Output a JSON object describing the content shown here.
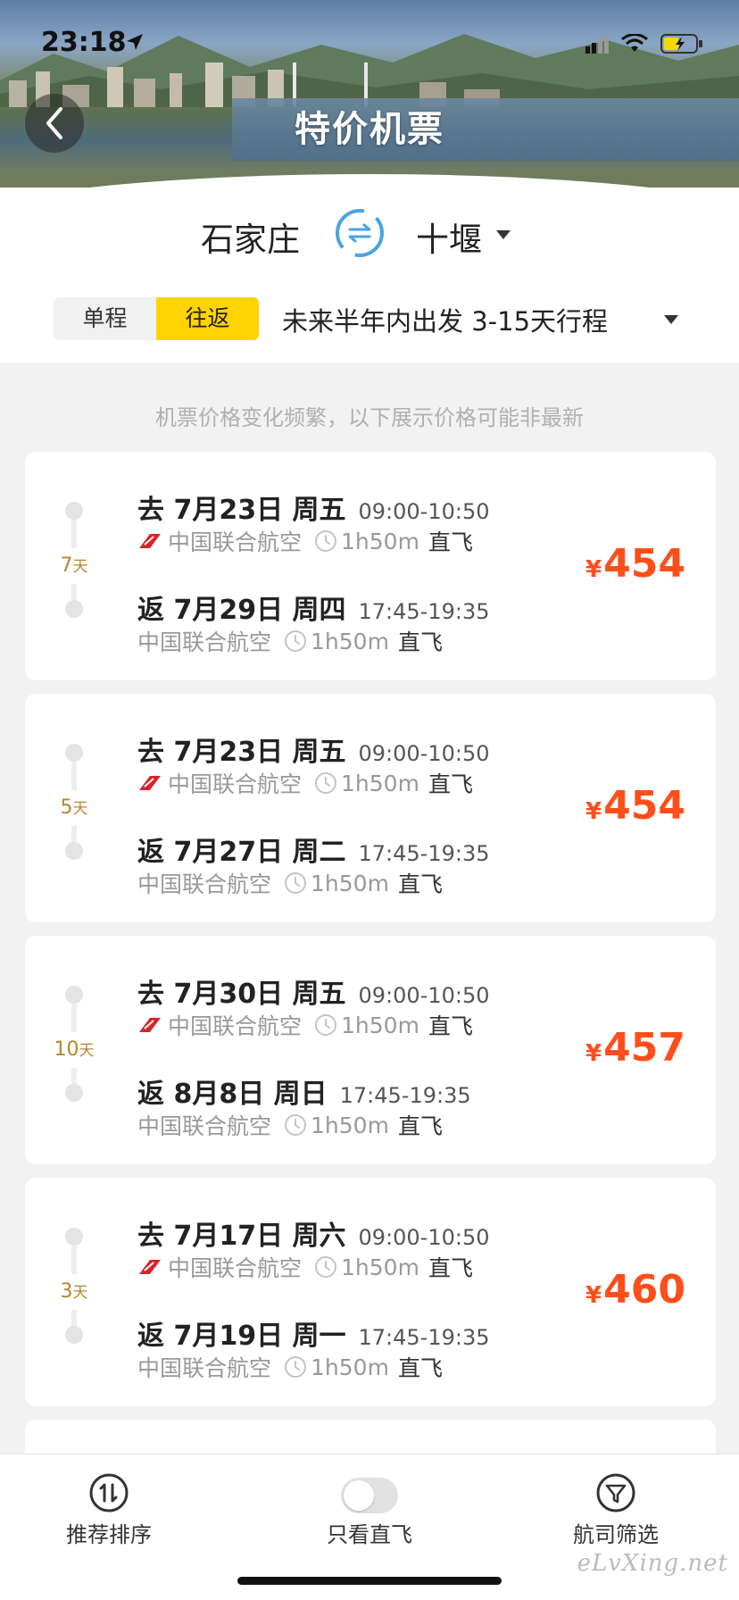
{
  "status": {
    "time": "23:18"
  },
  "header": {
    "title": "特价机票"
  },
  "route": {
    "from": "石家庄",
    "to": "十堰"
  },
  "trip_type": {
    "one_way": "单程",
    "round_trip": "往返",
    "selected": "往返"
  },
  "range": {
    "text": "未来半年内出发 3-15天行程"
  },
  "notice": "机票价格变化频繁，以下展示价格可能非最新",
  "colors": {
    "accent": "#ffd400",
    "price": "#ff4e1a",
    "days": "#b8842f"
  },
  "cards": [
    {
      "days": "7",
      "days_unit": "天",
      "out": {
        "date": "去 7月23日 周五",
        "time": "09:00-10:50",
        "airline": "中国联合航空",
        "duration": "1h50m",
        "type": "直飞"
      },
      "ret": {
        "date": "返 7月29日 周四",
        "time": "17:45-19:35",
        "airline": "中国联合航空",
        "duration": "1h50m",
        "type": "直飞"
      },
      "currency": "¥",
      "price": "454"
    },
    {
      "days": "5",
      "days_unit": "天",
      "out": {
        "date": "去 7月23日 周五",
        "time": "09:00-10:50",
        "airline": "中国联合航空",
        "duration": "1h50m",
        "type": "直飞"
      },
      "ret": {
        "date": "返 7月27日 周二",
        "time": "17:45-19:35",
        "airline": "中国联合航空",
        "duration": "1h50m",
        "type": "直飞"
      },
      "currency": "¥",
      "price": "454"
    },
    {
      "days": "10",
      "days_unit": "天",
      "out": {
        "date": "去 7月30日 周五",
        "time": "09:00-10:50",
        "airline": "中国联合航空",
        "duration": "1h50m",
        "type": "直飞"
      },
      "ret": {
        "date": "返 8月8日 周日",
        "time": "17:45-19:35",
        "airline": "中国联合航空",
        "duration": "1h50m",
        "type": "直飞"
      },
      "currency": "¥",
      "price": "457"
    },
    {
      "days": "3",
      "days_unit": "天",
      "out": {
        "date": "去 7月17日 周六",
        "time": "09:00-10:50",
        "airline": "中国联合航空",
        "duration": "1h50m",
        "type": "直飞"
      },
      "ret": {
        "date": "返 7月19日 周一",
        "time": "17:45-19:35",
        "airline": "中国联合航空",
        "duration": "1h50m",
        "type": "直飞"
      },
      "currency": "¥",
      "price": "460"
    }
  ],
  "bottom_bar": {
    "sort_label": "推荐排序",
    "direct_label": "只看直飞",
    "direct_only": false,
    "filter_label": "航司筛选"
  },
  "watermark": "eLvXing.net"
}
